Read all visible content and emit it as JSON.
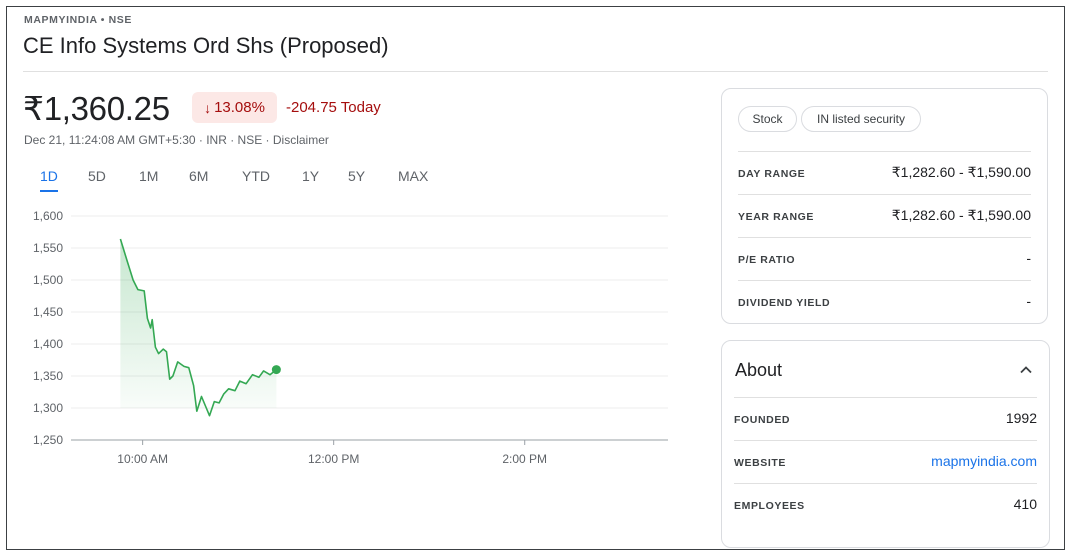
{
  "header": {
    "ticker": "MAPMYINDIA • NSE",
    "company": "CE Info Systems Ord Shs (Proposed)"
  },
  "quote": {
    "price": "₹1,360.25",
    "change_arrow": "↓",
    "change_pct": "13.08%",
    "change_today": "-204.75 Today",
    "meta": "Dec 21, 11:24:08 AM GMT+5:30 · INR · NSE · Disclaimer"
  },
  "tabs": [
    {
      "label": "1D",
      "active": true
    },
    {
      "label": "5D",
      "active": false
    },
    {
      "label": "1M",
      "active": false
    },
    {
      "label": "6M",
      "active": false
    },
    {
      "label": "YTD",
      "active": false
    },
    {
      "label": "1Y",
      "active": false
    },
    {
      "label": "5Y",
      "active": false
    },
    {
      "label": "MAX",
      "active": false
    }
  ],
  "chart_data": {
    "type": "line",
    "title": "",
    "xlabel": "",
    "ylabel": "",
    "ylim": [
      1250,
      1600
    ],
    "y_ticks": [
      "1,600",
      "1,550",
      "1,500",
      "1,450",
      "1,400",
      "1,350",
      "1,300",
      "1,250"
    ],
    "x_ticks": [
      {
        "label": "10:00 AM",
        "time": "10:00"
      },
      {
        "label": "12:00 PM",
        "time": "12:00"
      },
      {
        "label": "2:00 PM",
        "time": "14:00"
      }
    ],
    "x_range": [
      "09:15",
      "15:30"
    ],
    "series": [
      {
        "color": "#34a853",
        "points": [
          [
            "09:46",
            1564
          ],
          [
            "09:50",
            1532
          ],
          [
            "09:54",
            1500
          ],
          [
            "09:57",
            1485
          ],
          [
            "10:01",
            1483
          ],
          [
            "10:03",
            1440
          ],
          [
            "10:05",
            1425
          ],
          [
            "10:06",
            1438
          ],
          [
            "10:08",
            1395
          ],
          [
            "10:10",
            1385
          ],
          [
            "10:13",
            1392
          ],
          [
            "10:15",
            1388
          ],
          [
            "10:17",
            1345
          ],
          [
            "10:19",
            1350
          ],
          [
            "10:22",
            1372
          ],
          [
            "10:26",
            1365
          ],
          [
            "10:29",
            1363
          ],
          [
            "10:32",
            1335
          ],
          [
            "10:34",
            1295
          ],
          [
            "10:37",
            1318
          ],
          [
            "10:40",
            1300
          ],
          [
            "10:42",
            1288
          ],
          [
            "10:45",
            1310
          ],
          [
            "10:48",
            1308
          ],
          [
            "10:51",
            1322
          ],
          [
            "10:54",
            1330
          ],
          [
            "10:58",
            1327
          ],
          [
            "11:01",
            1342
          ],
          [
            "11:05",
            1338
          ],
          [
            "11:09",
            1352
          ],
          [
            "11:13",
            1348
          ],
          [
            "11:16",
            1358
          ],
          [
            "11:20",
            1352
          ],
          [
            "11:24",
            1360
          ]
        ]
      }
    ]
  },
  "stats": {
    "chips": [
      "Stock",
      "IN listed security"
    ],
    "rows": [
      {
        "label": "DAY RANGE",
        "value": "₹1,282.60 - ₹1,590.00"
      },
      {
        "label": "YEAR RANGE",
        "value": "₹1,282.60 - ₹1,590.00"
      },
      {
        "label": "P/E RATIO",
        "value": "-"
      },
      {
        "label": "DIVIDEND YIELD",
        "value": "-"
      }
    ]
  },
  "about": {
    "title": "About",
    "rows": [
      {
        "label": "FOUNDED",
        "value": "1992"
      },
      {
        "label": "WEBSITE",
        "value": "mapmyindia.com"
      },
      {
        "label": "EMPLOYEES",
        "value": "410"
      }
    ]
  },
  "colors": {
    "negative": "#a50e0e",
    "negative_bg": "#fce8e6",
    "accent": "#1a73e8",
    "line": "#34a853"
  }
}
